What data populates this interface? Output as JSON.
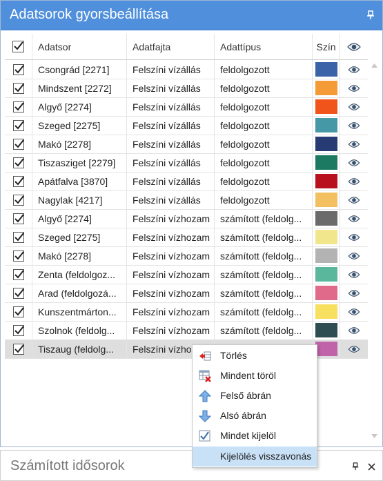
{
  "panel": {
    "title": "Adatsorok gyorsbeállítása"
  },
  "columns": {
    "series": "Adatsor",
    "kind": "Adatfajta",
    "type": "Adattípus",
    "color": "Szín"
  },
  "rows": [
    {
      "series": "Csongrád [2271]",
      "kind": "Felszíni vízállás",
      "type": "feldolgozott",
      "color": "#3b63a7"
    },
    {
      "series": "Mindszent [2272]",
      "kind": "Felszíni vízállás",
      "type": "feldolgozott",
      "color": "#f49b37"
    },
    {
      "series": "Algyő [2274]",
      "kind": "Felszíni vízállás",
      "type": "feldolgozott",
      "color": "#f0541b"
    },
    {
      "series": "Szeged [2275]",
      "kind": "Felszíni vízállás",
      "type": "feldolgozott",
      "color": "#4598a5"
    },
    {
      "series": "Makó [2278]",
      "kind": "Felszíni vízállás",
      "type": "feldolgozott",
      "color": "#263b73"
    },
    {
      "series": "Tiszasziget [2279]",
      "kind": "Felszíni vízállás",
      "type": "feldolgozott",
      "color": "#1d7a62"
    },
    {
      "series": "Apátfalva [3870]",
      "kind": "Felszíni vízállás",
      "type": "feldolgozott",
      "color": "#b8101c"
    },
    {
      "series": "Nagylak [4217]",
      "kind": "Felszíni vízállás",
      "type": "feldolgozott",
      "color": "#f2c060"
    },
    {
      "series": "Algyő [2274]",
      "kind": "Felszíni vízhozam",
      "type": "számított (feldolg...",
      "color": "#6b6b6b"
    },
    {
      "series": "Szeged [2275]",
      "kind": "Felszíni vízhozam",
      "type": "számított (feldolg...",
      "color": "#f2e68c"
    },
    {
      "series": "Makó [2278]",
      "kind": "Felszíni vízhozam",
      "type": "számított (feldolg...",
      "color": "#b3b3b3"
    },
    {
      "series": "Zenta (feldolgoz...",
      "kind": "Felszíni vízhozam",
      "type": "számított (feldolg...",
      "color": "#5bb79c"
    },
    {
      "series": "Arad (feldolgozá...",
      "kind": "Felszíni vízhozam",
      "type": "számított (feldolg...",
      "color": "#e06a8a"
    },
    {
      "series": "Kunszentmárton...",
      "kind": "Felszíni vízhozam",
      "type": "számított (feldolg...",
      "color": "#f7df5f"
    },
    {
      "series": "Szolnok (feldolg...",
      "kind": "Felszíni vízhozam",
      "type": "számított (feldolg...",
      "color": "#2e4d52"
    },
    {
      "series": "Tiszaug (feldolg...",
      "kind": "Felszíni vízhoz",
      "type": "",
      "color": "#c063a9"
    }
  ],
  "context_menu": {
    "items": [
      {
        "label": "Törlés",
        "icon": "delete-row-icon"
      },
      {
        "label": "Mindent töröl",
        "icon": "clear-all-icon"
      },
      {
        "label": "Felső ábrán",
        "icon": "arrow-up-icon"
      },
      {
        "label": "Alsó ábrán",
        "icon": "arrow-down-icon"
      },
      {
        "label": "Mindet kijelöl",
        "icon": "checkmark-icon"
      },
      {
        "label": "Kijelölés visszavonás",
        "icon": ""
      }
    ]
  },
  "panel2": {
    "title": "Számított idősorok"
  }
}
